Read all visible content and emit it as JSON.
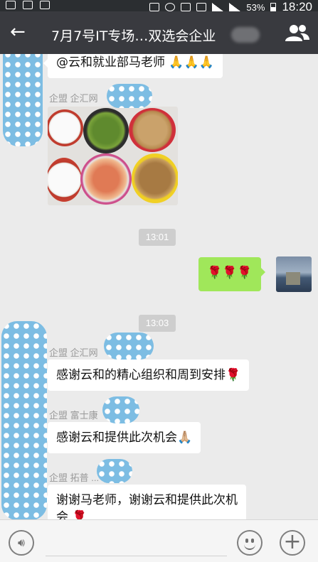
{
  "status_bar": {
    "battery": "53%",
    "time": "18:20",
    "icons": [
      "wechat-icon",
      "image-icon",
      "weibo-icon",
      "mute-icon",
      "alarm-icon",
      "wifi-icon",
      "heart-icon",
      "signal-icon",
      "signal-icon",
      "battery-icon"
    ]
  },
  "header": {
    "back_icon": "back-arrow-icon",
    "title": "7月7号IT专场…双选会企业",
    "members_icon": "group-members-icon"
  },
  "messages": [
    {
      "type": "text",
      "sender": "",
      "text": "@云和就业部马老师 🙏🙏🙏"
    },
    {
      "type": "image",
      "sender": "企盟 企汇网",
      "image": "meal-tray-photo"
    },
    {
      "type": "timestamp",
      "text": "13:01"
    },
    {
      "type": "text",
      "from_self": true,
      "text": "🌹🌹🌹"
    },
    {
      "type": "timestamp",
      "text": "13:03"
    },
    {
      "type": "text",
      "sender": "企盟 企汇网",
      "text": "感谢云和的精心组织和周到安排🌹"
    },
    {
      "type": "text",
      "sender": "企盟 富士康",
      "text": "感谢云和提供此次机会🙏🏼"
    },
    {
      "type": "text",
      "sender": "企盟 拓普 ...",
      "text": "谢谢马老师，谢谢云和提供此次机",
      "text2": "会 🌹"
    }
  ],
  "input_bar": {
    "voice_icon": "voice-input-icon",
    "emoji_icon": "emoji-icon",
    "plus_icon": "plus-icon"
  },
  "colors": {
    "title_bar": "#393a3f",
    "chat_bg": "#ebebeb",
    "self_bubble": "#a0e75a",
    "privacy_blob": "#7dbde3"
  }
}
